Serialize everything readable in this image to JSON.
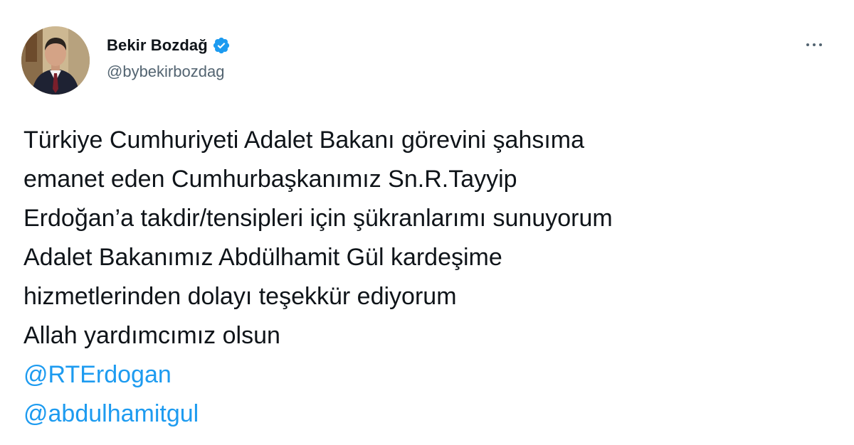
{
  "author": {
    "display_name": "Bekir Bozdağ",
    "handle": "@bybekirbozdag",
    "verified": true
  },
  "icons": {
    "verified": "verified-badge-icon",
    "more": "more-options-icon"
  },
  "colors": {
    "text": "#0f1419",
    "secondary": "#536471",
    "link": "#1d9bf0"
  },
  "tweet": {
    "lines": [
      "Türkiye Cumhuriyeti Adalet Bakanı görevini şahsıma",
      "emanet eden Cumhurbaşkanımız Sn.R.Tayyip",
      "Erdoğan’a takdir/tensipleri için şükranlarımı sunuyorum",
      "Adalet Bakanımız Abdülhamit Gül kardeşime",
      "hizmetlerinden dolayı teşekkür ediyorum",
      "Allah yardımcımız olsun"
    ],
    "mentions": [
      "@RTErdogan",
      "@abdulhamitgul"
    ]
  }
}
